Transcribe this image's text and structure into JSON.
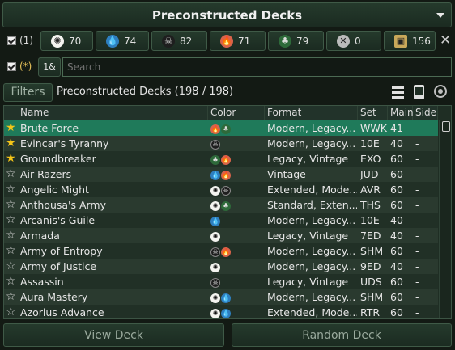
{
  "title": "Preconstructed Decks",
  "filter_row": {
    "all_label": "(1)",
    "colors": [
      {
        "icon": "white-mana-icon",
        "count": "70"
      },
      {
        "icon": "blue-mana-icon",
        "count": "74"
      },
      {
        "icon": "black-mana-icon",
        "count": "82"
      },
      {
        "icon": "red-mana-icon",
        "count": "71"
      },
      {
        "icon": "green-mana-icon",
        "count": "79"
      },
      {
        "icon": "colorless-mana-icon",
        "count": "0"
      },
      {
        "icon": "multicolor-card-icon",
        "count": "156"
      }
    ]
  },
  "search": {
    "wild_label": "(*)",
    "mode_label": "1&",
    "placeholder": "Search"
  },
  "filters_bar": {
    "button": "Filters",
    "caption": "Preconstructed Decks (198 / 198)"
  },
  "table": {
    "columns": [
      "Name",
      "Color",
      "Format",
      "Set",
      "Main",
      "Side"
    ],
    "rows": [
      {
        "fav": true,
        "name": "Brute Force",
        "colors": [
          "r",
          "g"
        ],
        "format": "Modern, Legacy...",
        "set": "WWK",
        "main": "41",
        "side": "-",
        "selected": true
      },
      {
        "fav": true,
        "name": "Evincar's Tyranny",
        "colors": [
          "b"
        ],
        "format": "Modern, Legacy...",
        "set": "10E",
        "main": "40",
        "side": "-"
      },
      {
        "fav": true,
        "name": "Groundbreaker",
        "colors": [
          "g",
          "r"
        ],
        "format": "Legacy, Vintage",
        "set": "EXO",
        "main": "60",
        "side": "-"
      },
      {
        "fav": false,
        "name": "Air Razers",
        "colors": [
          "u",
          "r"
        ],
        "format": "Vintage",
        "set": "JUD",
        "main": "60",
        "side": "-"
      },
      {
        "fav": false,
        "name": "Angelic Might",
        "colors": [
          "w",
          "b"
        ],
        "format": "Extended, Mode...",
        "set": "AVR",
        "main": "60",
        "side": "-"
      },
      {
        "fav": false,
        "name": "Anthousa's Army",
        "colors": [
          "w",
          "g"
        ],
        "format": "Standard, Exten...",
        "set": "THS",
        "main": "60",
        "side": "-"
      },
      {
        "fav": false,
        "name": "Arcanis's Guile",
        "colors": [
          "u"
        ],
        "format": "Modern, Legacy...",
        "set": "10E",
        "main": "40",
        "side": "-"
      },
      {
        "fav": false,
        "name": "Armada",
        "colors": [
          "w"
        ],
        "format": "Legacy, Vintage",
        "set": "7ED",
        "main": "40",
        "side": "-"
      },
      {
        "fav": false,
        "name": "Army of Entropy",
        "colors": [
          "b",
          "r"
        ],
        "format": "Modern, Legacy...",
        "set": "SHM",
        "main": "60",
        "side": "-"
      },
      {
        "fav": false,
        "name": "Army of Justice",
        "colors": [
          "w"
        ],
        "format": "Modern, Legacy...",
        "set": "9ED",
        "main": "40",
        "side": "-"
      },
      {
        "fav": false,
        "name": "Assassin",
        "colors": [
          "b"
        ],
        "format": "Legacy, Vintage",
        "set": "UDS",
        "main": "60",
        "side": "-"
      },
      {
        "fav": false,
        "name": "Aura Mastery",
        "colors": [
          "w",
          "u"
        ],
        "format": "Modern, Legacy...",
        "set": "SHM",
        "main": "60",
        "side": "-"
      },
      {
        "fav": false,
        "name": "Azorius Advance",
        "colors": [
          "w",
          "u"
        ],
        "format": "Extended, Mode...",
        "set": "RTR",
        "main": "60",
        "side": "-"
      }
    ]
  },
  "buttons": {
    "view": "View Deck",
    "random": "Random Deck"
  },
  "colors": {
    "selected_row": "#1f7a5a",
    "star": "#f5c518",
    "row_even": "#213026",
    "row_odd": "#2a3a2f"
  }
}
